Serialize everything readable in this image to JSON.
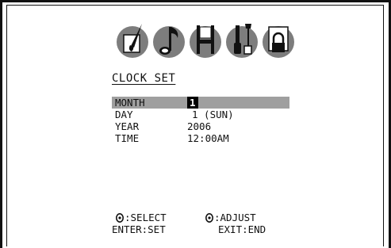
{
  "menu_icons": [
    {
      "name": "picture-brush-icon"
    },
    {
      "name": "music-note-icon"
    },
    {
      "name": "bench-icon"
    },
    {
      "name": "tools-icon"
    },
    {
      "name": "lock-icon"
    }
  ],
  "title": "CLOCK SET",
  "settings": [
    {
      "label": "MONTH",
      "value": "1",
      "selected": true
    },
    {
      "label": "DAY",
      "value": "1 (SUN)"
    },
    {
      "label": "YEAR",
      "value": "2006"
    },
    {
      "label": "TIME",
      "value": "12:00AM"
    }
  ],
  "footer": {
    "select_hint": ":SELECT",
    "adjust_hint": ":ADJUST",
    "enter_hint": "ENTER:SET",
    "exit_hint": "EXIT:END"
  }
}
